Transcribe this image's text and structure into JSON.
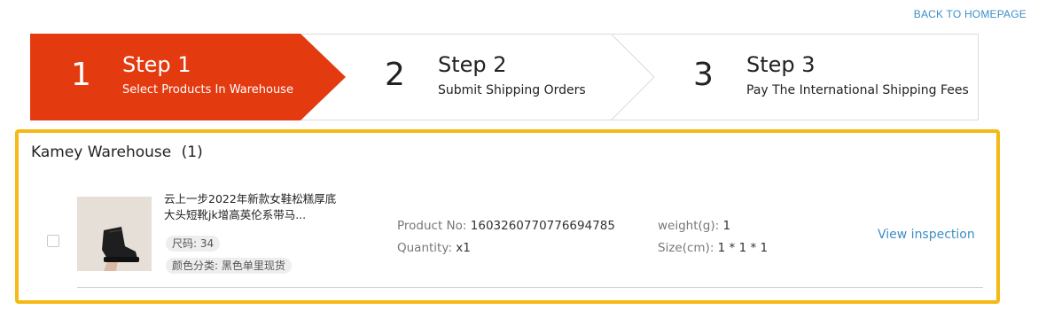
{
  "header": {
    "back_link": "BACK TO HOMEPAGE"
  },
  "steps": [
    {
      "number": "1",
      "title": "Step 1",
      "subtitle": "Select Products In Warehouse",
      "active": true
    },
    {
      "number": "2",
      "title": "Step 2",
      "subtitle": "Submit Shipping Orders",
      "active": false
    },
    {
      "number": "3",
      "title": "Step 3",
      "subtitle": "Pay The International Shipping Fees",
      "active": false
    }
  ],
  "colors": {
    "active_step": "#e33a10",
    "highlight_border": "#f5b915",
    "link": "#3d8ec7"
  },
  "warehouse": {
    "name": "Kamey Warehouse",
    "count": "(1)",
    "items": [
      {
        "product_name": "云上一步2022年新款女鞋松糕厚底大头短靴jk增高英伦系带马...",
        "tags": [
          "尺码: 34",
          "颜色分类: 黑色单里现货"
        ],
        "product_no_label": "Product No:",
        "product_no": "1603260770776694785",
        "quantity_label": "Quantity:",
        "quantity": "x1",
        "weight_label": "weight(g):",
        "weight": "1",
        "size_label": "Size(cm):",
        "size": "1 * 1 * 1",
        "action": "View inspection"
      }
    ]
  }
}
